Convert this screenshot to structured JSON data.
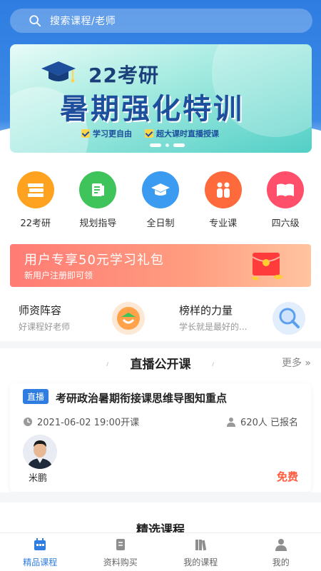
{
  "search": {
    "placeholder": "搜索课程/老师"
  },
  "banner": {
    "line1": "22考研",
    "line2": "暑期强化特训",
    "tags": [
      "学习更自由",
      "超大课时直播授课"
    ]
  },
  "categories": [
    {
      "label": "22考研",
      "icon": "book-stack-icon",
      "color": "#ffa21f"
    },
    {
      "label": "规划指导",
      "icon": "document-icon",
      "color": "#3fc35b"
    },
    {
      "label": "全日制",
      "icon": "graduation-cap-icon",
      "color": "#3a9bf0"
    },
    {
      "label": "专业课",
      "icon": "people-icon",
      "color": "#ff6a3d"
    },
    {
      "label": "四六级",
      "icon": "open-book-icon",
      "color": "#ff4f6b"
    }
  ],
  "promo": {
    "title": "用户专享50元学习礼包",
    "subtitle": "新用户注册即可领"
  },
  "features": [
    {
      "title": "师资阵容",
      "subtitle": "好课程好老师"
    },
    {
      "title": "榜样的力量",
      "subtitle": "学长就是最好的..."
    }
  ],
  "live": {
    "section_title": "直播公开课",
    "more_label": "更多 »",
    "badge": "直播",
    "course_title": "考研政治暑期衔接课思维导图知重点",
    "time": "2021-06-02 19:00开课",
    "enrolled": "620人 已报名",
    "teacher": "米鹏",
    "price": "免费"
  },
  "featured": {
    "section_title": "精选课程"
  },
  "tabs": [
    {
      "label": "精品课程",
      "icon": "calendar-icon",
      "active": true
    },
    {
      "label": "资料购买",
      "icon": "document-icon",
      "active": false
    },
    {
      "label": "我的课程",
      "icon": "books-icon",
      "active": false
    },
    {
      "label": "我的",
      "icon": "user-icon",
      "active": false
    }
  ],
  "colors": {
    "primary": "#2f7de1",
    "price": "#ff5a3c"
  }
}
